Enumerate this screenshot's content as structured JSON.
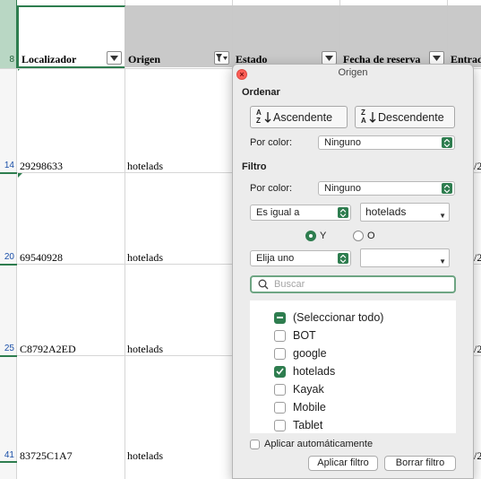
{
  "sheet": {
    "header_row_number": "8",
    "headers": [
      {
        "label": "Localizador",
        "filtered": false
      },
      {
        "label": "Origen",
        "filtered": true
      },
      {
        "label": "Estado",
        "filtered": false
      },
      {
        "label": "Fecha de reserva",
        "filtered": false
      },
      {
        "label": "Entrad",
        "filtered": false
      }
    ],
    "rows": [
      {
        "row_number": "14",
        "localizador": "29298633",
        "origen": "hotelads",
        "entrada_partial": "/2"
      },
      {
        "row_number": "20",
        "localizador": "69540928",
        "origen": "hotelads",
        "entrada_partial": "/2"
      },
      {
        "row_number": "25",
        "localizador": "C8792A2ED",
        "origen": "hotelads",
        "entrada_partial": "/2"
      },
      {
        "row_number": "41",
        "localizador": "83725C1A7",
        "origen": "hotelads",
        "entrada_partial": "/2"
      }
    ]
  },
  "filter_popup": {
    "title": "Origen",
    "sort": {
      "section_label": "Ordenar",
      "ascending_label": "Ascendente",
      "descending_label": "Descendente",
      "by_color_label": "Por color:",
      "by_color_value": "Ninguno"
    },
    "filter": {
      "section_label": "Filtro",
      "by_color_label": "Por color:",
      "by_color_value": "Ninguno",
      "condition1_operator": "Es igual a",
      "condition1_value": "hotelads",
      "and_label": "Y",
      "or_label": "O",
      "and_selected": true,
      "condition2_operator": "Elija uno",
      "condition2_value": ""
    },
    "search_placeholder": "Buscar",
    "values": [
      {
        "label": "(Seleccionar todo)",
        "state": "mixed"
      },
      {
        "label": "BOT",
        "state": "unchecked"
      },
      {
        "label": "google",
        "state": "unchecked"
      },
      {
        "label": "hotelads",
        "state": "checked"
      },
      {
        "label": "Kayak",
        "state": "unchecked"
      },
      {
        "label": "Mobile",
        "state": "unchecked"
      },
      {
        "label": "Tablet",
        "state": "unchecked"
      }
    ],
    "auto_apply_label": "Aplicar automáticamente",
    "auto_apply_checked": false,
    "apply_button": "Aplicar filtro",
    "clear_button": "Borrar filtro"
  },
  "colors": {
    "accent": "#2e7d4f",
    "header_grey": "#c9c9c9",
    "row_number": "#1a4fa8"
  }
}
